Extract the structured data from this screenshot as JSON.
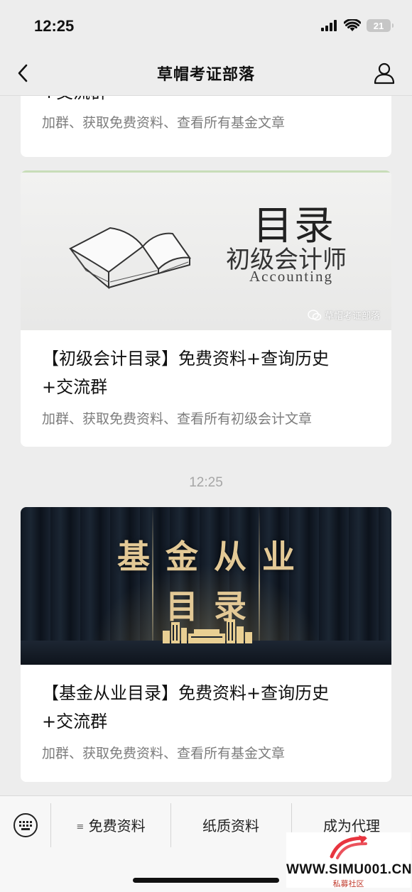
{
  "status_bar": {
    "time": "12:25",
    "battery": "21"
  },
  "nav": {
    "title": "草帽考证部落"
  },
  "feed": {
    "partial_card": {
      "title_tail": "+交流群",
      "subtitle": "加群、获取免费资料、查看所有基金文章"
    },
    "card_accounting": {
      "cover_big": "目录",
      "cover_mid": "初级会计师",
      "cover_en": "Accounting",
      "cover_watermark": "草帽考证部落",
      "title_line1": "【初级会计目录】免费资料+查询历史",
      "title_line2": "+交流群",
      "subtitle": "加群、获取免费资料、查看所有初级会计文章"
    },
    "time_separator": "12:25",
    "card_fund": {
      "cover_line1": "基金从业",
      "cover_line2": "目录",
      "title_line1": "【基金从业目录】免费资料+查询历史",
      "title_line2": "+交流群",
      "subtitle": "加群、获取免费资料、查看所有基金文章"
    }
  },
  "bottom_menu": {
    "items": [
      {
        "label": "免费资料",
        "has_list_icon": true
      },
      {
        "label": "纸质资料"
      },
      {
        "label": "成为代理"
      }
    ]
  },
  "watermark": {
    "url": "WWW.SIMU001.CN",
    "sub": "私募社区",
    "brand_color": "#e8343f"
  }
}
